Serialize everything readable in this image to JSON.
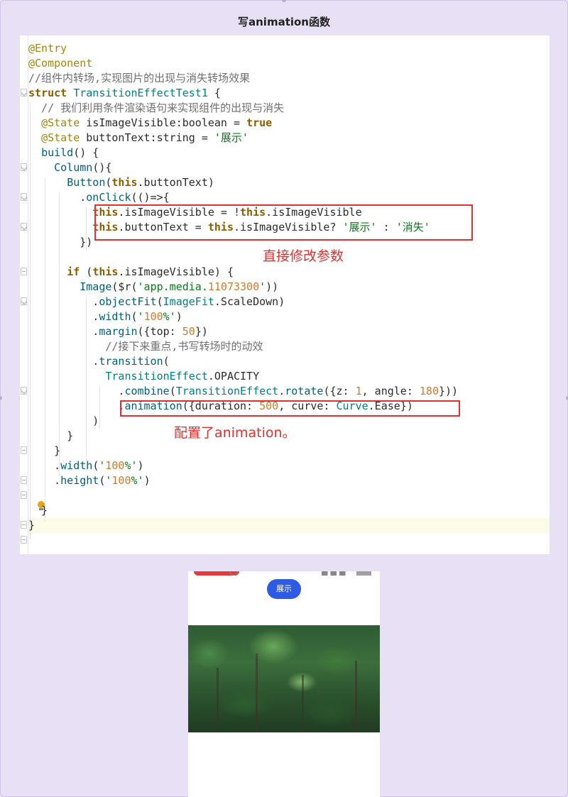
{
  "title": "写animation函数",
  "code": {
    "lines": [
      "@Entry",
      "@Component",
      "//组件内转场,实现图片的出现与消失转场效果",
      "struct TransitionEffectTest1 {",
      "  // 我们利用条件渲染语句来实现组件的出现与消失",
      "  @State isImageVisible:boolean = true",
      "  @State buttonText:string = '展示'",
      "  build() {",
      "    Column(){",
      "      Button(this.buttonText)",
      "        .onClick(()=>{",
      "          this.isImageVisible = !this.isImageVisible",
      "          this.buttonText = this.isImageVisible? '展示' : '消失'",
      "        })",
      "",
      "      if (this.isImageVisible) {",
      "        Image($r('app.media.11073300'))",
      "          .objectFit(ImageFit.ScaleDown)",
      "          .width('100%')",
      "          .margin({top: 50})",
      "            //接下来重点,书写转场时的动效",
      "          .transition(",
      "            TransitionEffect.OPACITY",
      "              .combine(TransitionEffect.rotate({z: 1, angle: 180}))",
      "              .animation({duration: 500, curve: Curve.Ease})",
      "          )",
      "      }",
      "    }",
      "    .width('100%')",
      "    .height('100%')",
      "",
      "  }",
      "}"
    ]
  },
  "annotations": {
    "direct_modify": "直接修改参数",
    "configured_animation": "配置了animation。"
  },
  "preview": {
    "button_label": "展示",
    "image_alt": "forest image"
  },
  "colors": {
    "background": "#e8e0f5",
    "annotation_red": "#e03030",
    "button_blue": "#2e5be6"
  }
}
